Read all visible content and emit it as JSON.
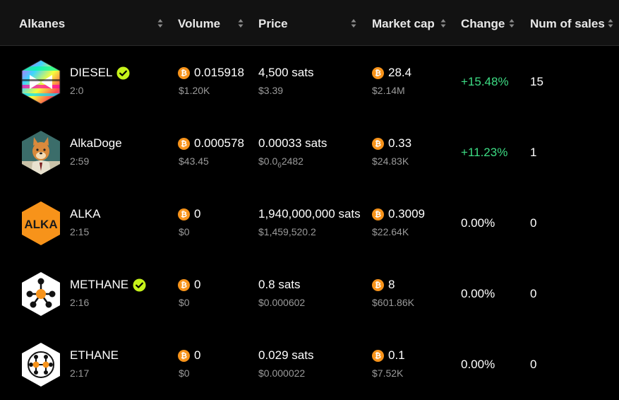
{
  "columns": {
    "alkanes": "Alkanes",
    "volume": "Volume",
    "price": "Price",
    "market_cap": "Market cap",
    "change": "Change",
    "num_sales": "Num of sales"
  },
  "colors": {
    "positive": "#3ddc84",
    "btc": "#f7931a",
    "verified": "#c6f31a",
    "alka_brand": "#f7931a"
  },
  "rows": [
    {
      "name": "DIESEL",
      "verified": true,
      "id": "2:0",
      "volume_btc": "0.015918",
      "volume_usd": "$1.20K",
      "price_sats": "4,500 sats",
      "price_usd": "$3.39",
      "mcap_btc": "28.4",
      "mcap_usd": "$2.14M",
      "change": "+15.48%",
      "sales": "15",
      "logo_icon": "diesel-rainbow-icon"
    },
    {
      "name": "AlkaDoge",
      "verified": false,
      "id": "2:59",
      "volume_btc": "0.000578",
      "volume_usd": "$43.45",
      "price_sats": "0.00033 sats",
      "price_usd_prefix": "$0.0",
      "price_usd_subscript": "6",
      "price_usd_suffix": "2482",
      "mcap_btc": "0.33",
      "mcap_usd": "$24.83K",
      "change": "+11.23%",
      "sales": "1",
      "logo_icon": "doge-icon"
    },
    {
      "name": "ALKA",
      "verified": false,
      "id": "2:15",
      "volume_btc": "0",
      "volume_usd": "$0",
      "price_sats": "1,940,000,000 sats",
      "price_usd": "$1,459,520.2",
      "mcap_btc": "0.3009",
      "mcap_usd": "$22.64K",
      "change": "0.00%",
      "sales": "0",
      "logo_icon": "alka-icon",
      "logo_text": "ALKA"
    },
    {
      "name": "METHANE",
      "verified": true,
      "id": "2:16",
      "volume_btc": "0",
      "volume_usd": "$0",
      "price_sats": "0.8 sats",
      "price_usd": "$0.000602",
      "mcap_btc": "8",
      "mcap_usd": "$601.86K",
      "change": "0.00%",
      "sales": "0",
      "logo_icon": "methane-molecule-icon"
    },
    {
      "name": "ETHANE",
      "verified": false,
      "id": "2:17",
      "volume_btc": "0",
      "volume_usd": "$0",
      "price_sats": "0.029 sats",
      "price_usd": "$0.000022",
      "mcap_btc": "0.1",
      "mcap_usd": "$7.52K",
      "change": "0.00%",
      "sales": "0",
      "logo_icon": "ethane-molecule-icon"
    }
  ]
}
